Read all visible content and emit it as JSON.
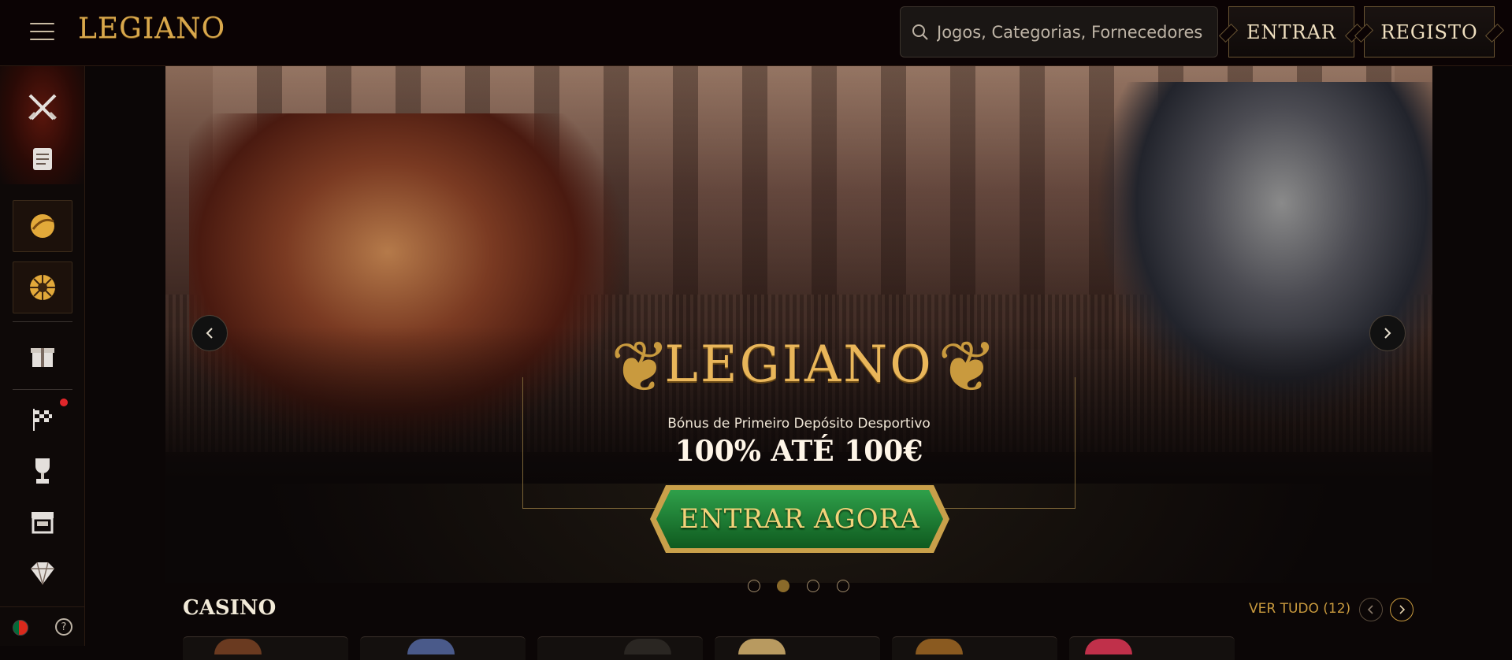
{
  "header": {
    "logo_text": "LEGIANO",
    "search_placeholder": "Jogos, Categorias, Fornecedores",
    "login_label": "ENTRAR",
    "register_label": "REGISTO"
  },
  "sidebar": {
    "items": [
      {
        "icon": "swords-icon"
      },
      {
        "icon": "scroll-icon"
      },
      {
        "icon": "sports-ball-icon"
      },
      {
        "icon": "wheel-icon"
      },
      {
        "icon": "gift-icon"
      },
      {
        "icon": "racing-flag-icon",
        "notification": true
      },
      {
        "icon": "trophy-icon"
      },
      {
        "icon": "shop-icon"
      },
      {
        "icon": "diamond-icon"
      }
    ],
    "language_flag": "portugal-flag-icon",
    "help_icon": "help-icon"
  },
  "banner": {
    "logo_text": "LEGIANO",
    "subtitle": "Bónus de Primeiro Depósito Desportivo",
    "offer": "100% ATÉ 100€",
    "cta_label": "ENTRAR AGORA",
    "slides_count": 4,
    "active_slide": 2
  },
  "casino": {
    "title": "CASINO",
    "see_all": "VER TUDO (12)"
  },
  "colors": {
    "accent_gold": "#c99a3e",
    "cta_green": "#1f7a2c",
    "background": "#0b0606"
  }
}
